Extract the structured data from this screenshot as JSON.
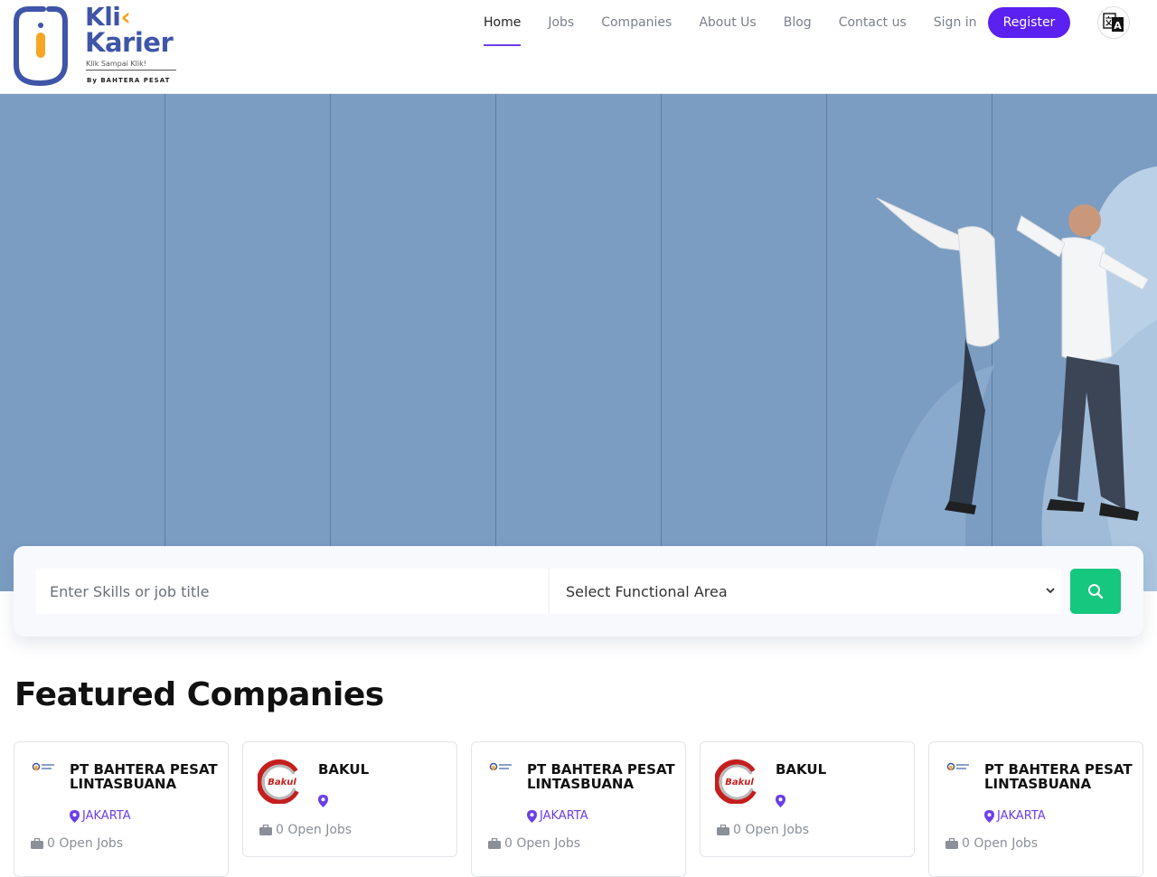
{
  "brand": {
    "name_line1": "Kli",
    "name_line1_chevron": "‹",
    "name_line2": "Karier",
    "tagline": "Klik Sampai Klik!",
    "by": "By   BAHTERA PESAT",
    "color": "#3f55a8",
    "accent": "#f5a623"
  },
  "nav": {
    "items": [
      {
        "label": "Home",
        "active": true
      },
      {
        "label": "Jobs"
      },
      {
        "label": "Companies"
      },
      {
        "label": "About Us"
      },
      {
        "label": "Blog"
      },
      {
        "label": "Contact us"
      },
      {
        "label": "Sign in"
      }
    ],
    "register_label": "Register",
    "register_color": "#5b21f0",
    "language_icon": "translate-icon"
  },
  "hero": {
    "background": "#7b9dc1"
  },
  "search": {
    "placeholder": "Enter Skills or job title",
    "functional_area": "Select Functional Area",
    "button_icon": "search-icon",
    "button_color": "#15c77f"
  },
  "featured": {
    "title": "Featured Companies",
    "companies": [
      {
        "name": "PT BAHTERA PESAT LINTASBUANA",
        "location": "JAKARTA",
        "jobs": "0 Open Jobs"
      },
      {
        "name": "BAKUL",
        "location": "",
        "jobs": "0 Open Jobs"
      },
      {
        "name": "PT BAHTERA PESAT LINTASBUANA",
        "location": "JAKARTA",
        "jobs": "0 Open Jobs"
      },
      {
        "name": "BAKUL",
        "location": "",
        "jobs": "0 Open Jobs"
      },
      {
        "name": "PT BAHTERA PESAT LINTASBUANA",
        "location": "JAKARTA",
        "jobs": "0 Open Jobs"
      }
    ]
  }
}
